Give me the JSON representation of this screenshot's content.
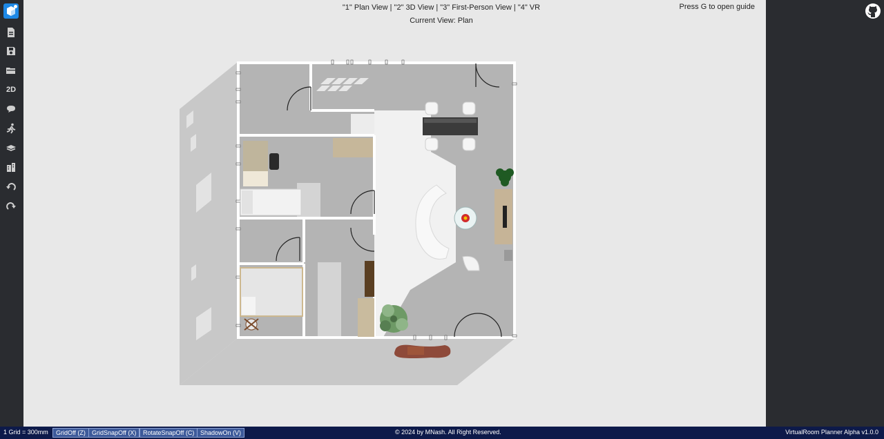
{
  "sidebar": {
    "logo_icon": "app-logo-cube-icon",
    "tools": [
      {
        "name": "new-file-icon"
      },
      {
        "name": "save-icon"
      },
      {
        "name": "open-folder-icon"
      },
      {
        "name": "view-2d",
        "label": "2D"
      },
      {
        "name": "view-3d-icon"
      },
      {
        "name": "walk-icon"
      },
      {
        "name": "layers-icon"
      },
      {
        "name": "building-icon"
      },
      {
        "name": "undo-icon"
      },
      {
        "name": "redo-icon"
      }
    ]
  },
  "header": {
    "view_modes": "\"1\" Plan View | \"2\" 3D View | \"3\" First-Person View | \"4\" VR",
    "current_view": "Current View: Plan",
    "guide_hint": "Press G to open guide"
  },
  "rightpanel": {
    "github_icon": "github-icon"
  },
  "footer": {
    "grid_label": "1 Grid = 300mm",
    "buttons": [
      "GridOff (Z)",
      "GridSnapOff (X)",
      "RotateSnapOff (C)",
      "ShadowOn (V)"
    ],
    "copyright": "© 2024 by MNash. All Right Reserved.",
    "version": "VirtualRoom Planner Alpha v1.0.0"
  },
  "colors": {
    "panel": "#2a2c30",
    "viewport": "#e8e8e8",
    "footer": "#0d1a4a",
    "footer_button": "#3d5a9a"
  }
}
